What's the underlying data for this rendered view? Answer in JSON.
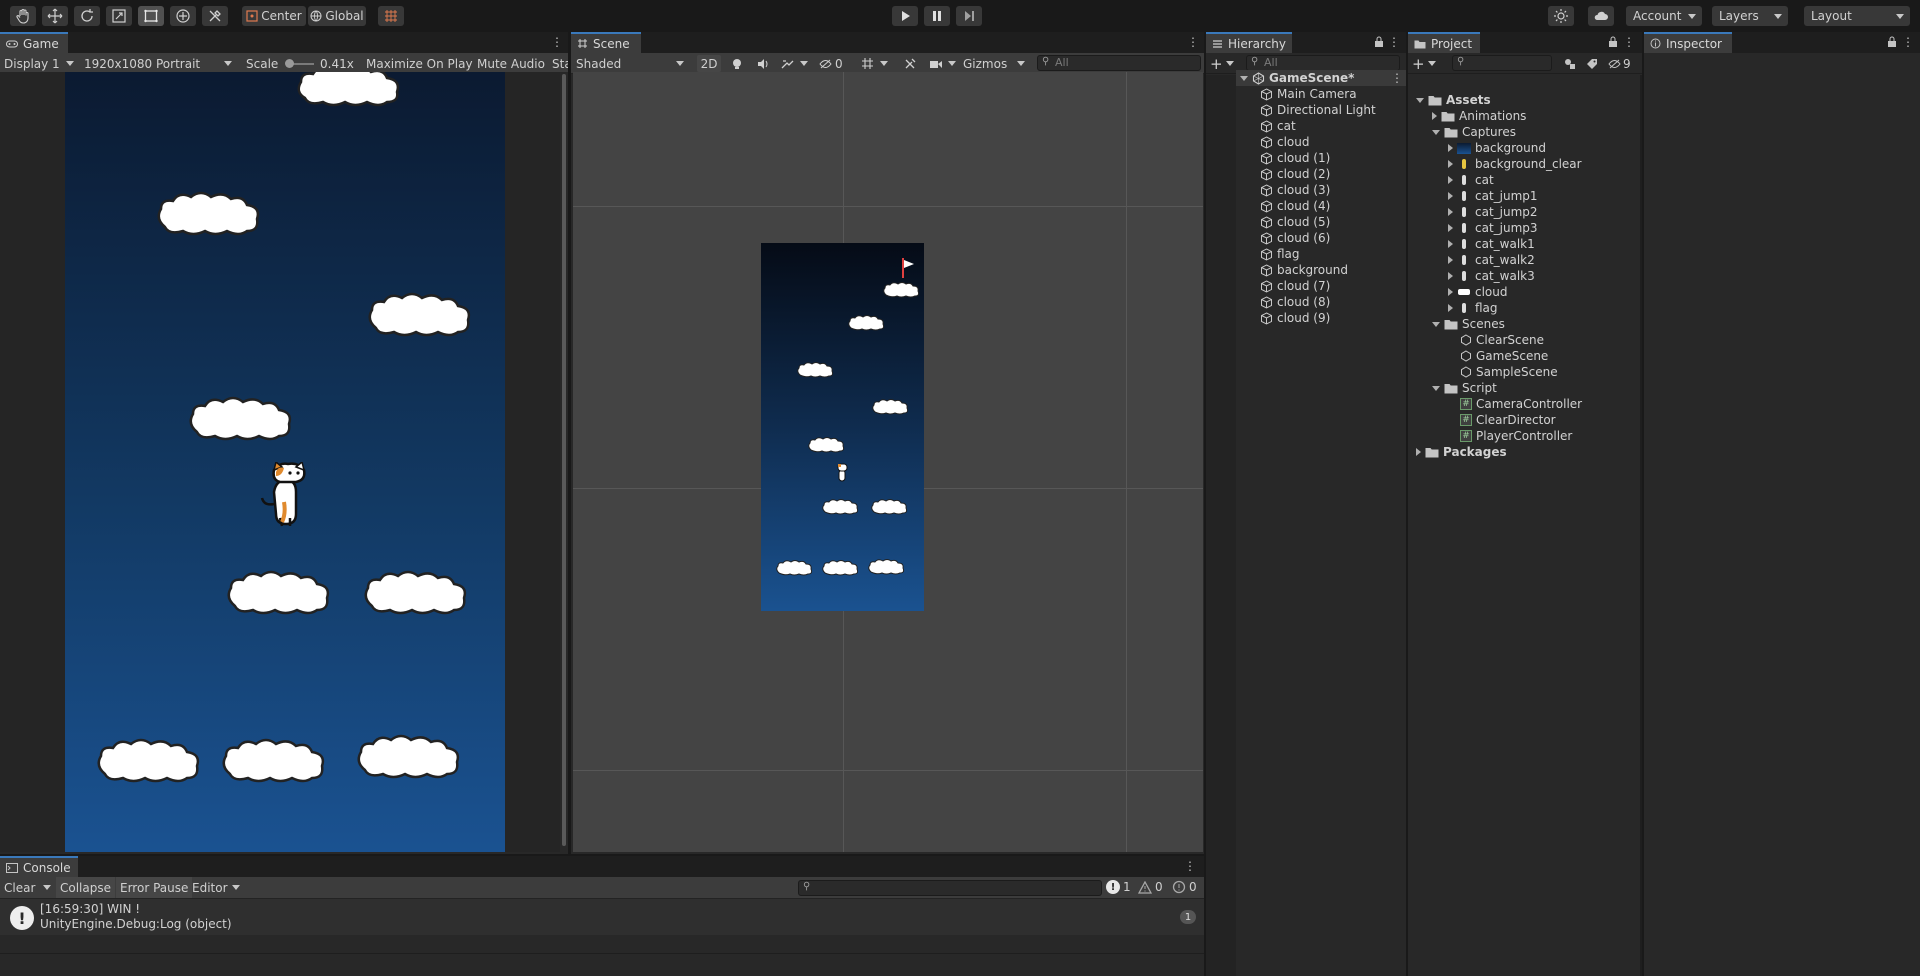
{
  "toolbar": {
    "pivot_label": "Center",
    "space_label": "Global",
    "account_label": "Account",
    "layers_label": "Layers",
    "layout_label": "Layout"
  },
  "game": {
    "tab": "Game",
    "display": "Display 1",
    "resolution": "1920x1080 Portrait",
    "scale_label": "Scale",
    "scale_value": "0.41x",
    "maximize": "Maximize On Play",
    "mute": "Mute Audio",
    "stats": "Sta"
  },
  "scene": {
    "tab": "Scene",
    "shading": "Shaded",
    "mode_2d": "2D",
    "hidden_count": "0",
    "gizmos": "Gizmos",
    "search_placeholder": "All"
  },
  "hierarchy": {
    "tab": "Hierarchy",
    "search_placeholder": "All",
    "scene_name": "GameScene*",
    "items": [
      "Main Camera",
      "Directional Light",
      "cat",
      "cloud",
      "cloud (1)",
      "cloud (2)",
      "cloud (3)",
      "cloud (4)",
      "cloud (5)",
      "cloud (6)",
      "flag",
      "background",
      "cloud (7)",
      "cloud (8)",
      "cloud (9)"
    ]
  },
  "project": {
    "tab": "Project",
    "hidden_count": "9",
    "root": "Assets",
    "animations": "Animations",
    "captures": "Captures",
    "captures_items": [
      "background",
      "background_clear",
      "cat",
      "cat_jump1",
      "cat_jump2",
      "cat_jump3",
      "cat_walk1",
      "cat_walk2",
      "cat_walk3",
      "cloud",
      "flag"
    ],
    "scenes": "Scenes",
    "scenes_items": [
      "ClearScene",
      "GameScene",
      "SampleScene"
    ],
    "script": "Script",
    "script_items": [
      "CameraController",
      "ClearDirector",
      "PlayerController"
    ],
    "packages": "Packages"
  },
  "inspector": {
    "tab": "Inspector"
  },
  "console": {
    "tab": "Console",
    "clear": "Clear",
    "collapse": "Collapse",
    "error_pause": "Error Pause",
    "editor": "Editor",
    "count_info": "1",
    "count_warn": "0",
    "count_error": "0",
    "log_line1": "[16:59:30] WIN !",
    "log_line2": "UnityEngine.Debug:Log (object)",
    "log_count": "1"
  },
  "colors": {
    "accent": "#3a79bb",
    "sky_top": "#0b1a31",
    "sky_bottom": "#1a5291"
  }
}
